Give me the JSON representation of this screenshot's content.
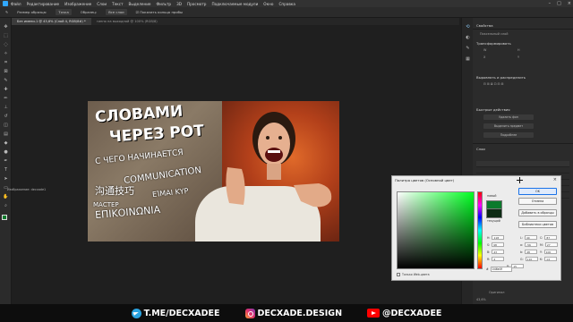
{
  "menubar": {
    "items": [
      "Файл",
      "Редактирование",
      "Изображение",
      "Слои",
      "Текст",
      "Выделение",
      "Фильтр",
      "3D",
      "Просмотр",
      "Подключаемые модули",
      "Окно",
      "Справка"
    ]
  },
  "options": {
    "size_label": "Размер образца:",
    "size_value": "Точка",
    "sample_label": "Образец:",
    "sample_value": "Все слои",
    "ring_label": "Показать кольцо пробы"
  },
  "tabs": [
    {
      "label": "Без имени-1 @ 43,6% (Слой 4, RGB/8#) *",
      "active": true
    },
    {
      "label": "гиппо на выходной @ 100% (RGB/8)",
      "active": false
    }
  ],
  "canvas_overlay": {
    "credit": "Изображение: decxade1"
  },
  "thumbnail": {
    "headline_line1": "СЛОВАМИ",
    "headline_line2": "ЧЕРЕЗ РОТ",
    "sub1": "С ЧЕГО НАЧИНАЕТСЯ",
    "sub2": "COMMUNICATION",
    "sub3": "沟通技巧",
    "sub4": "ΕΊΜΑΙ ΚΥΡ",
    "sub5": "МАСТЕР",
    "sub6": "ΕΠΙΚΟΙΝΩΝΙΑ"
  },
  "panels": {
    "properties_title": "Свойства",
    "pixel_layer": "Пиксельный слой",
    "transform_title": "Трансформировать",
    "align_title": "Выровнять и распределить",
    "quick_actions_title": "Быстрые действия",
    "qa_btn1": "Удалить фон",
    "qa_btn2": "Выделить предмет",
    "qa_btn3": "Подробнее",
    "layers_title": "Слои",
    "layer_bottom_name": "Оригинал",
    "zoom": "43,6%"
  },
  "picker": {
    "title": "Палитра цветов (Основной цвет)",
    "new_label": "новый",
    "current_label": "текущий",
    "ok": "OK",
    "cancel": "Отмена",
    "add_swatch": "Добавить в образцы",
    "libraries": "Библиотеки цветов",
    "h_label": "H:",
    "h_value": "118",
    "s_label": "S:",
    "s_value": "98",
    "b_label": "B:",
    "b_value": "43",
    "r_label": "R:",
    "r_value": "4",
    "g_label": "G:",
    "g_value": "110",
    "bl_label": "B:",
    "bl_value": "15",
    "l_label": "L:",
    "l_value": "40",
    "a_label": "a:",
    "a_value": "-56",
    "bb_label": "b:",
    "bb_value": "48",
    "c_label": "C:",
    "c_value": "87",
    "m_label": "M:",
    "m_value": "27",
    "y_label": "Y:",
    "y_value": "100",
    "k_label": "K:",
    "k_value": "14",
    "hex_label": "#",
    "hex_value": "046e0f",
    "web_only": "Только Web-цвета",
    "colors": {
      "new": "#0b7a2c",
      "current": "#0d2b14"
    }
  },
  "watermark": {
    "telegram": "T.ME/DECXADEE",
    "instagram": "DECXADE.DESIGN",
    "youtube": "@DECXADEE"
  },
  "icons": [
    "telegram-icon",
    "instagram-icon",
    "youtube-icon",
    "close-icon",
    "eyedropper-icon"
  ]
}
